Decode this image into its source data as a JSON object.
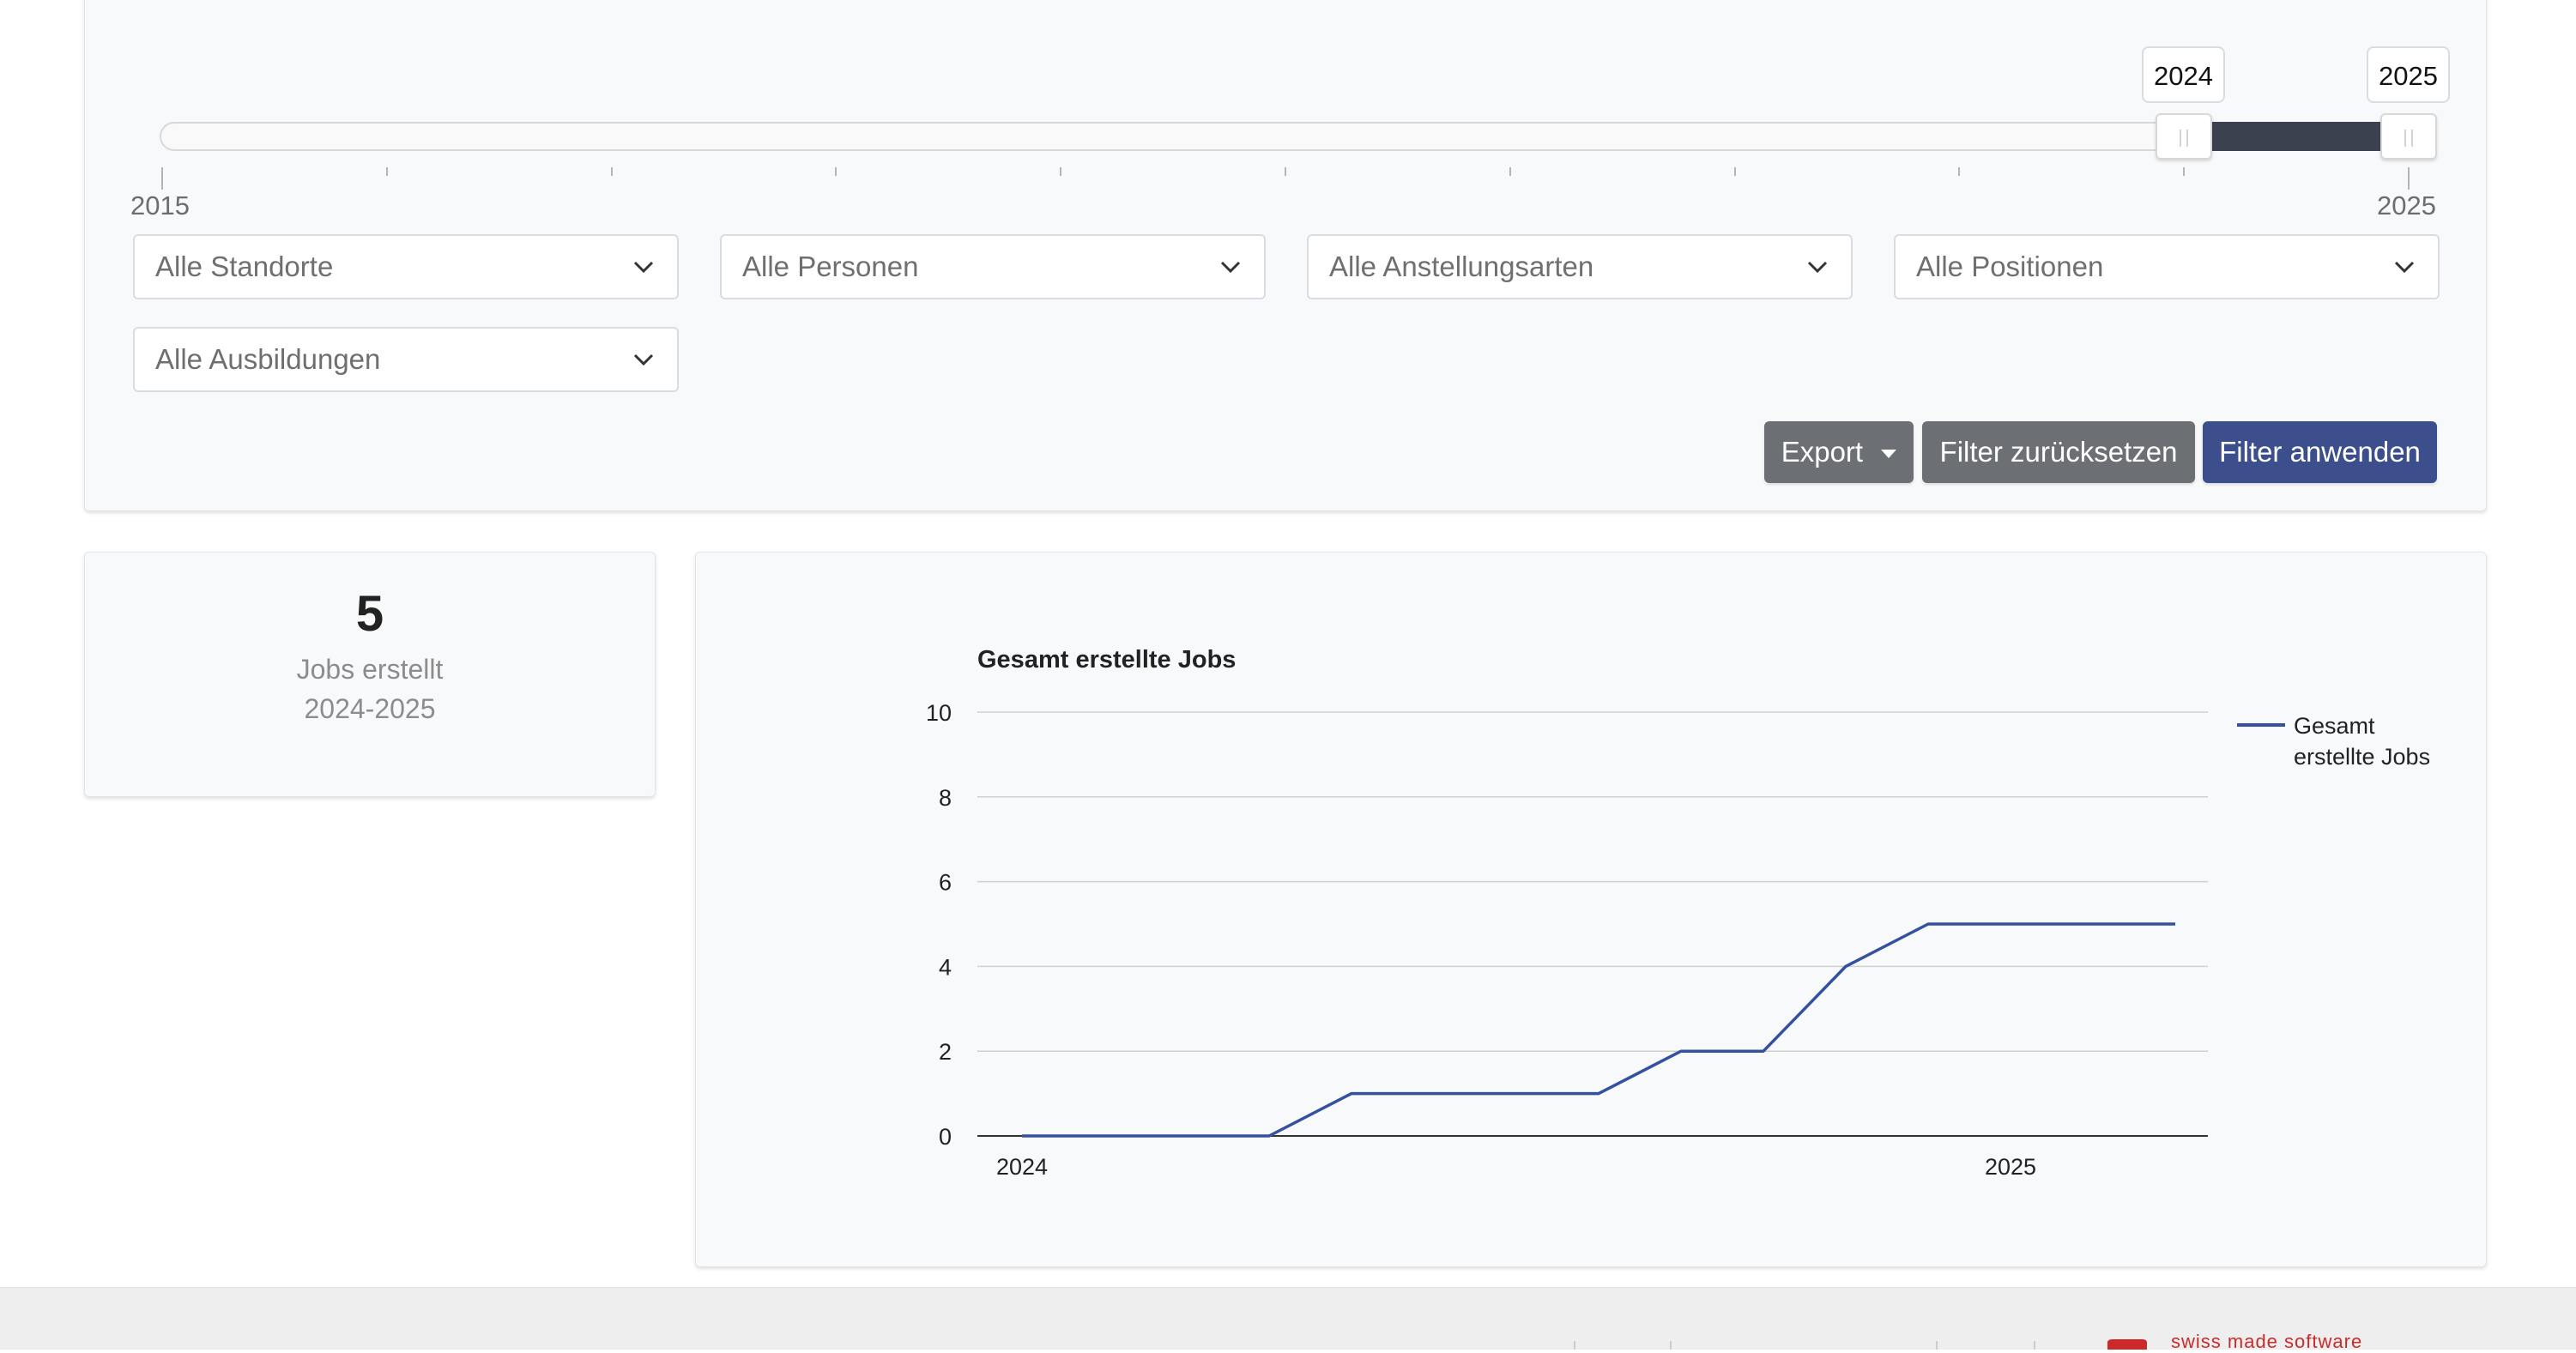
{
  "year_slider": {
    "start_label": "2015",
    "end_label": "2025",
    "selected_from": "2024",
    "selected_to": "2025",
    "years": [
      2015,
      2016,
      2017,
      2018,
      2019,
      2020,
      2021,
      2022,
      2023,
      2024,
      2025
    ],
    "selected_range": [
      2024,
      2025
    ]
  },
  "filters": {
    "locations": "Alle Standorte",
    "persons": "Alle Personen",
    "employment_types": "Alle Anstellungsarten",
    "positions": "Alle Positionen",
    "educations": "Alle Ausbildungen"
  },
  "actions": {
    "export_label": "Export",
    "reset_label": "Filter zurücksetzen",
    "apply_label": "Filter anwenden"
  },
  "stat": {
    "value": "5",
    "label": "Jobs erstellt",
    "period": "2024-2025"
  },
  "chart_data": {
    "type": "line",
    "title": "Gesamt erstellte Jobs",
    "x_tick_labels": [
      "2024",
      "2025"
    ],
    "x_range": [
      "2024-01",
      "2025-03"
    ],
    "x": [
      "2024-01",
      "2024-02",
      "2024-03",
      "2024-04",
      "2024-05",
      "2024-06",
      "2024-07",
      "2024-08",
      "2024-09",
      "2024-10",
      "2024-11",
      "2024-12",
      "2025-01",
      "2025-02",
      "2025-03"
    ],
    "series": [
      {
        "name": "Gesamt erstellte Jobs",
        "values": [
          0,
          0,
          0,
          0,
          1,
          1,
          1,
          1,
          2,
          2,
          4,
          5,
          5,
          5,
          5
        ]
      }
    ],
    "ylim": [
      0,
      10
    ],
    "y_ticks": [
      0,
      2,
      4,
      6,
      8,
      10
    ],
    "grid": true,
    "legend_position": "right",
    "colors": {
      "series": "#3451a0",
      "grid": "#cfcfcf",
      "axis": "#333333"
    }
  },
  "footer": {
    "brand_text": "swiss made software",
    "brand_color": "#cc2a2a"
  }
}
